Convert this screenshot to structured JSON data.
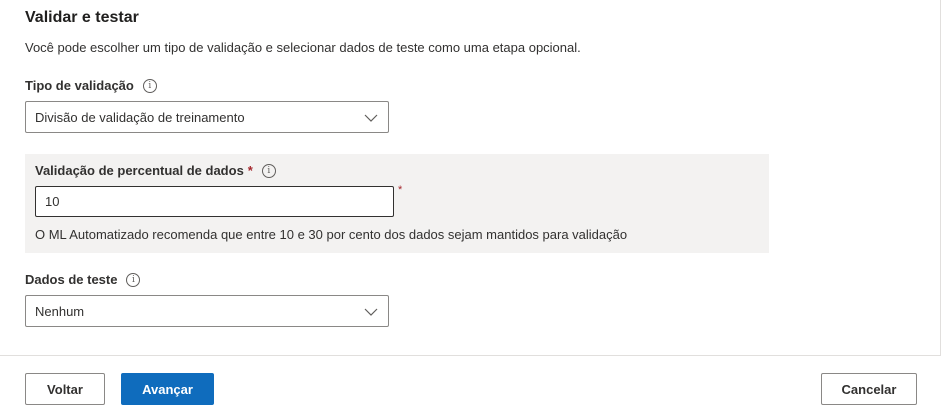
{
  "section": {
    "title": "Validar e testar",
    "description": "Você pode escolher um tipo de validação e selecionar dados de teste como uma etapa opcional."
  },
  "validation_type": {
    "label": "Tipo de validação",
    "info_icon": "ⓘ",
    "selected": "Divisão de validação de treinamento"
  },
  "validation_percent": {
    "label": "Validação de percentual de dados",
    "required_mark": "*",
    "info_icon": "ⓘ",
    "value": "10",
    "side_required_mark": "*",
    "hint": "O ML Automatizado recomenda que entre 10 e 30 por cento dos dados sejam mantidos para validação"
  },
  "test_data": {
    "label": "Dados de teste",
    "info_icon": "ⓘ",
    "selected": "Nenhum"
  },
  "footer": {
    "back_label": "Voltar",
    "next_label": "Avançar",
    "cancel_label": "Cancelar"
  },
  "colors": {
    "primary": "#0f6cbd",
    "required": "#a4262c",
    "panel_bg": "#f3f2f1"
  }
}
